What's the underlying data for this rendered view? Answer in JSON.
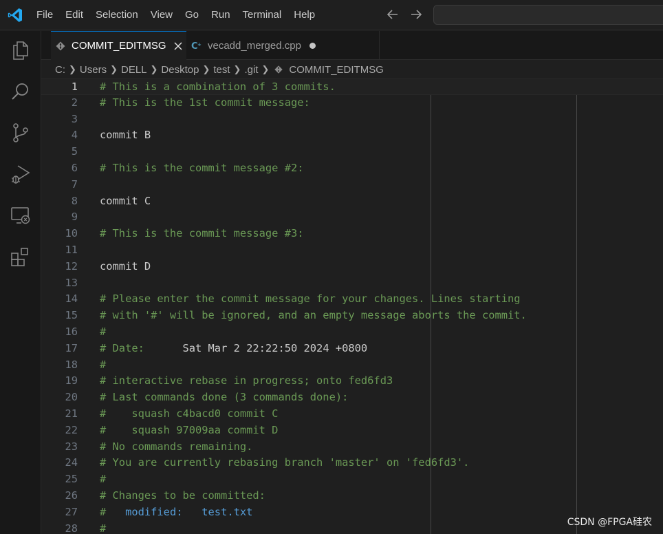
{
  "menu": [
    "File",
    "Edit",
    "Selection",
    "View",
    "Go",
    "Run",
    "Terminal",
    "Help"
  ],
  "tabs": [
    {
      "label": "COMMIT_EDITMSG",
      "active": true,
      "icon": "git-icon",
      "indicator": "close"
    },
    {
      "label": "vecadd_merged.cpp",
      "active": false,
      "icon": "cpp-icon",
      "indicator": "unsaved-dot"
    }
  ],
  "breadcrumb": [
    "C:",
    "Users",
    "DELL",
    "Desktop",
    "test",
    ".git",
    "COMMIT_EDITMSG"
  ],
  "editor": {
    "current_line": 1,
    "lines": [
      {
        "n": "1",
        "parts": [
          [
            "comment",
            "# This is a combination of 3 commits."
          ]
        ]
      },
      {
        "n": "2",
        "parts": [
          [
            "comment",
            "# This is the 1st commit message:"
          ]
        ]
      },
      {
        "n": "3",
        "parts": []
      },
      {
        "n": "4",
        "parts": [
          [
            "plain",
            "commit B"
          ]
        ]
      },
      {
        "n": "5",
        "parts": []
      },
      {
        "n": "6",
        "parts": [
          [
            "comment",
            "# This is the commit message #2:"
          ]
        ]
      },
      {
        "n": "7",
        "parts": []
      },
      {
        "n": "8",
        "parts": [
          [
            "plain",
            "commit C"
          ]
        ]
      },
      {
        "n": "9",
        "parts": []
      },
      {
        "n": "10",
        "parts": [
          [
            "comment",
            "# This is the commit message #3:"
          ]
        ]
      },
      {
        "n": "11",
        "parts": []
      },
      {
        "n": "12",
        "parts": [
          [
            "plain",
            "commit D"
          ]
        ]
      },
      {
        "n": "13",
        "parts": []
      },
      {
        "n": "14",
        "parts": [
          [
            "comment",
            "# Please enter the commit message for your changes. Lines starting"
          ]
        ]
      },
      {
        "n": "15",
        "parts": [
          [
            "comment",
            "# with '#' will be ignored, and an empty message aborts the commit."
          ]
        ]
      },
      {
        "n": "16",
        "parts": [
          [
            "comment",
            "#"
          ]
        ]
      },
      {
        "n": "17",
        "parts": [
          [
            "comment",
            "# Date:      "
          ],
          [
            "plain",
            "Sat Mar 2 22:22:50 2024 +0800"
          ]
        ]
      },
      {
        "n": "18",
        "parts": [
          [
            "comment",
            "#"
          ]
        ]
      },
      {
        "n": "19",
        "parts": [
          [
            "comment",
            "# interactive rebase in progress; onto fed6fd3"
          ]
        ]
      },
      {
        "n": "20",
        "parts": [
          [
            "comment",
            "# Last commands done (3 commands done):"
          ]
        ]
      },
      {
        "n": "21",
        "parts": [
          [
            "comment",
            "#    squash c4bacd0 commit C"
          ]
        ]
      },
      {
        "n": "22",
        "parts": [
          [
            "comment",
            "#    squash 97009aa commit D"
          ]
        ]
      },
      {
        "n": "23",
        "parts": [
          [
            "comment",
            "# No commands remaining."
          ]
        ]
      },
      {
        "n": "24",
        "parts": [
          [
            "comment",
            "# You are currently rebasing branch 'master' on 'fed6fd3'."
          ]
        ]
      },
      {
        "n": "25",
        "parts": [
          [
            "comment",
            "#"
          ]
        ]
      },
      {
        "n": "26",
        "parts": [
          [
            "comment",
            "# Changes to be committed:"
          ]
        ]
      },
      {
        "n": "27",
        "parts": [
          [
            "comment",
            "#  "
          ],
          [
            "keyword",
            " modified:   test.txt"
          ]
        ]
      },
      {
        "n": "28",
        "parts": [
          [
            "comment",
            "#"
          ]
        ]
      }
    ]
  },
  "watermark": "CSDN @FPGA硅农",
  "colors": {
    "accent": "#0078d4",
    "comment": "#6a9955",
    "keyword": "#569cd6",
    "logo": "#23a9f2"
  }
}
